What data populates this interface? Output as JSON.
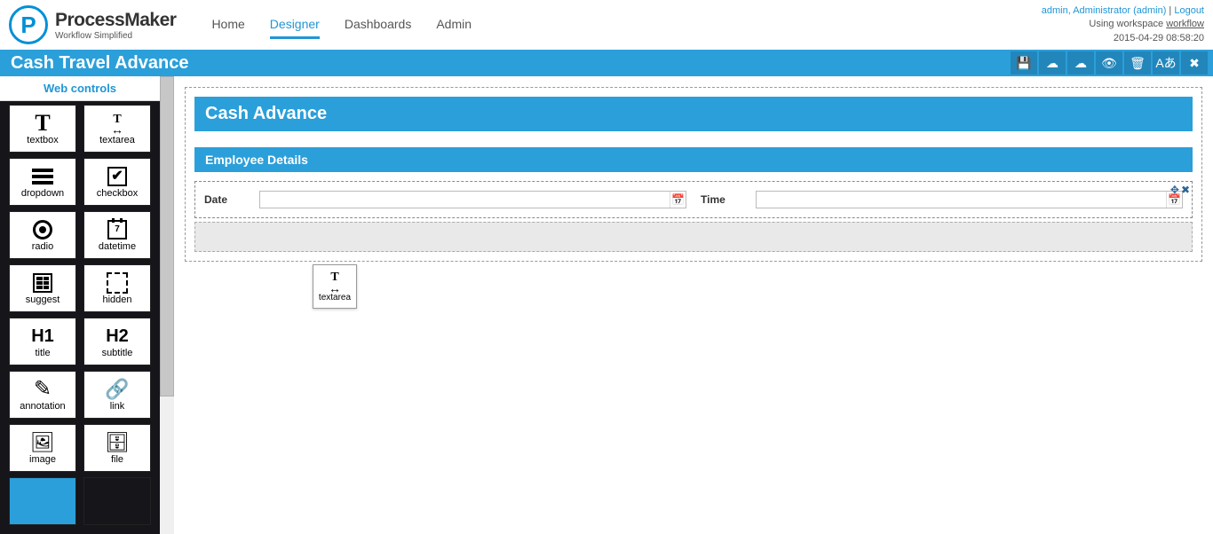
{
  "header": {
    "brand_title": "ProcessMaker",
    "brand_sub": "Workflow Simplified",
    "nav": [
      "Home",
      "Designer",
      "Dashboards",
      "Admin"
    ],
    "active_nav": 1,
    "user_line": "admin, Administrator (admin)",
    "logout": "Logout",
    "workspace_prefix": "Using workspace ",
    "workspace": "workflow",
    "timestamp": "2015-04-29 08:58:20"
  },
  "titlebar": {
    "title": "Cash Travel Advance"
  },
  "sidebar": {
    "tab": "Web controls",
    "controls": [
      {
        "label": "textbox"
      },
      {
        "label": "textarea"
      },
      {
        "label": "dropdown"
      },
      {
        "label": "checkbox"
      },
      {
        "label": "radio"
      },
      {
        "label": "datetime"
      },
      {
        "label": "suggest"
      },
      {
        "label": "hidden"
      },
      {
        "label": "title"
      },
      {
        "label": "subtitle"
      },
      {
        "label": "annotation"
      },
      {
        "label": "link"
      },
      {
        "label": "image"
      },
      {
        "label": "file"
      }
    ]
  },
  "form": {
    "title": "Cash Advance",
    "subtitle": "Employee Details",
    "fields": {
      "date_label": "Date",
      "time_label": "Time"
    }
  },
  "drag": {
    "label": "textarea"
  },
  "calendar_day": "7"
}
